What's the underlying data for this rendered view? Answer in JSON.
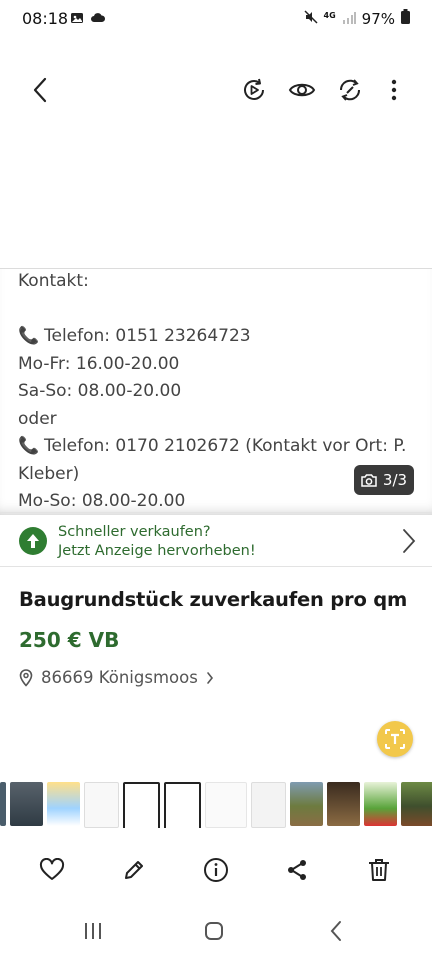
{
  "status_bar": {
    "time": "08:18",
    "network": "4G",
    "battery": "97%"
  },
  "icons": {
    "back": "chevron-left-icon",
    "slideshow": "play-rotate-icon",
    "eye": "eye-icon",
    "rotate": "rotate-icon",
    "more": "more-vertical-icon"
  },
  "gallery": {
    "lines": [
      "Kontakt:",
      "",
      "Telefon: 0151 23264723",
      "Mo-Fr: 16.00-20.00",
      "Sa-So: 08.00-20.00",
      "oder",
      "Telefon: 0170 2102672 (Kontakt vor Ort: P.",
      "Kleber)",
      "Mo-So: 08.00-20.00"
    ],
    "counter": "3/3"
  },
  "promo": {
    "line1": "Schneller verkaufen?",
    "line2": "Jetzt Anzeige hervorheben!"
  },
  "listing": {
    "title": "Baugrundstück  zuverkaufen pro qm",
    "price": "250 € VB",
    "location": "86669 Königsmoos"
  },
  "colors": {
    "accent_green": "#2e6b2f",
    "ai_button": "#f2c84b",
    "counter_bg": "#3a3a3a"
  }
}
